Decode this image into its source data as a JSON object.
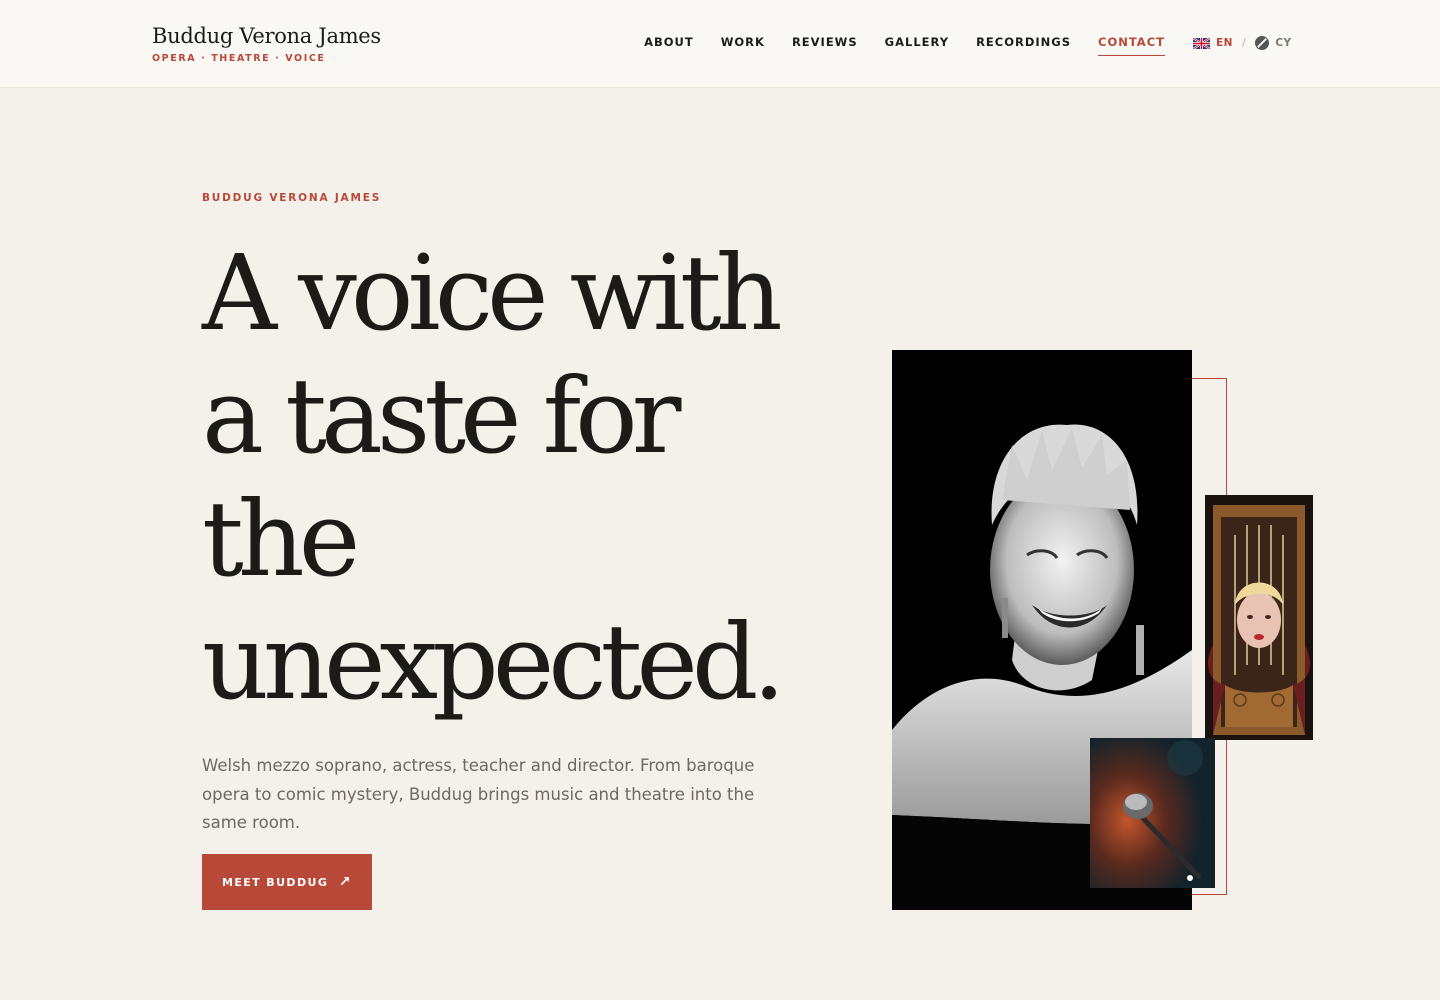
{
  "header": {
    "brand_name": "Buddug Verona James",
    "brand_tagline": "OPERA · THEATRE · VOICE",
    "nav": [
      {
        "label": "ABOUT"
      },
      {
        "label": "WORK"
      },
      {
        "label": "REVIEWS"
      },
      {
        "label": "GALLERY"
      },
      {
        "label": "RECORDINGS"
      },
      {
        "label": "CONTACT",
        "active": true
      }
    ],
    "lang": {
      "en": "EN",
      "cy": "CY",
      "active": "EN"
    }
  },
  "hero": {
    "eyebrow": "BUDDUG VERONA JAMES",
    "headline_lines": [
      "A voice with",
      "a taste for",
      "the",
      "unexpected."
    ],
    "lede": "Welsh mezzo soprano, actress, teacher and director. From baroque opera to comic mystery, Buddug brings music and theatre into the same room.",
    "cta_label": "MEET BUDDUG",
    "cta_arrow": "↗"
  },
  "colors": {
    "accent": "#b84838",
    "background": "#f4f1ea",
    "text": "#1d1b18"
  },
  "icons": {
    "cta_icon": "arrow-up-right-icon",
    "lang_en_icon": "uk-flag-icon",
    "lang_cy_icon": "globe-icon"
  }
}
